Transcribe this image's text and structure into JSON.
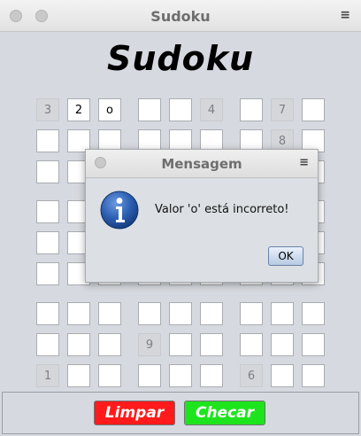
{
  "window": {
    "title": "Sudoku",
    "menu_glyph": "≡"
  },
  "app": {
    "heading": "Sudoku"
  },
  "board": {
    "rows": [
      [
        "3",
        "2",
        "o",
        "",
        "",
        "4",
        "",
        "7",
        ""
      ],
      [
        "",
        "",
        "",
        "",
        "",
        "",
        "",
        "8",
        ""
      ],
      [
        "",
        "",
        "",
        "",
        "",
        "",
        "",
        "",
        ""
      ],
      [
        "",
        "",
        "",
        "",
        "",
        "",
        "",
        "",
        ""
      ],
      [
        "",
        "",
        "",
        "",
        "",
        "",
        "",
        "",
        ""
      ],
      [
        "",
        "",
        "",
        "",
        "",
        "",
        "",
        "",
        ""
      ],
      [
        "",
        "",
        "",
        "",
        "",
        "",
        "",
        "",
        ""
      ],
      [
        "",
        "",
        "",
        "9",
        "",
        "",
        "",
        "",
        ""
      ],
      [
        "1",
        "",
        "",
        "",
        "",
        "",
        "6",
        "",
        ""
      ]
    ],
    "fixed": [
      [
        true,
        false,
        false,
        false,
        false,
        true,
        false,
        true,
        false
      ],
      [
        false,
        false,
        false,
        false,
        false,
        false,
        false,
        true,
        false
      ],
      [
        false,
        false,
        false,
        false,
        false,
        false,
        false,
        false,
        false
      ],
      [
        false,
        false,
        false,
        false,
        false,
        false,
        false,
        false,
        false
      ],
      [
        false,
        false,
        false,
        false,
        false,
        false,
        false,
        false,
        false
      ],
      [
        false,
        false,
        false,
        false,
        false,
        false,
        false,
        false,
        false
      ],
      [
        false,
        false,
        false,
        false,
        false,
        false,
        false,
        false,
        false
      ],
      [
        false,
        false,
        false,
        true,
        false,
        false,
        false,
        false,
        false
      ],
      [
        true,
        false,
        false,
        false,
        false,
        false,
        true,
        false,
        false
      ]
    ]
  },
  "buttons": {
    "clear_label": "Limpar",
    "check_label": "Checar"
  },
  "colors": {
    "clear": "#ff1b1b",
    "check": "#1ee41e",
    "info": "#2a5db0"
  },
  "dialog": {
    "title": "Mensagem",
    "menu_glyph": "≡",
    "message": "Valor 'o' está incorreto!",
    "ok_label": "OK",
    "icon": "info-icon"
  }
}
